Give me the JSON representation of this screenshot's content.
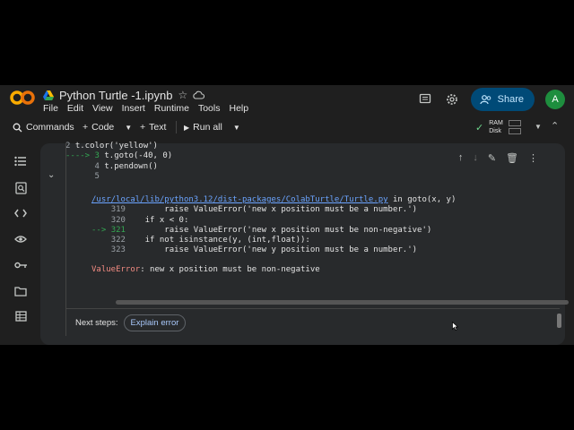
{
  "header": {
    "doc_title": "Python Turtle -1.ipynb",
    "menu": [
      "File",
      "Edit",
      "View",
      "Insert",
      "Runtime",
      "Tools",
      "Help"
    ],
    "share_label": "Share",
    "avatar_letter": "A"
  },
  "toolbar": {
    "commands_label": "Commands",
    "code_label": "Code",
    "text_label": "Text",
    "run_all_label": "Run all",
    "ram_label": "RAM",
    "disk_label": "Disk"
  },
  "code": {
    "lines": [
      {
        "num": "2",
        "prefix": "",
        "text": "t.color('yellow')"
      },
      {
        "num": "3",
        "prefix": "----> ",
        "text": "t.goto(-40, 0)"
      },
      {
        "num": "4",
        "prefix": "",
        "text": "t.pendown()"
      },
      {
        "num": "5",
        "prefix": "",
        "text": ""
      }
    ]
  },
  "traceback": {
    "path": "/usr/local/lib/python3.12/dist-packages/ColabTurtle/Turtle.py",
    "location": " in goto(x, y)",
    "lines": [
      {
        "num": "319",
        "arrow": "",
        "text": "        raise ValueError('new x position must be a number.')"
      },
      {
        "num": "320",
        "arrow": "",
        "text": "    if x < 0:"
      },
      {
        "num": "321",
        "arrow": "--> ",
        "text": "        raise ValueError('new x position must be non-negative')"
      },
      {
        "num": "322",
        "arrow": "",
        "text": "    if not isinstance(y, (int,float)):"
      },
      {
        "num": "323",
        "arrow": "",
        "text": "        raise ValueError('new y position must be a number.')"
      }
    ]
  },
  "error": {
    "type": "ValueError",
    "message": ": new x position must be non-negative"
  },
  "next_steps": {
    "label": "Next steps:",
    "button": "Explain error"
  },
  "colors": {
    "background": "#1f1f1f",
    "accent": "#004a77",
    "error": "#f28b82",
    "link": "#6ba4ff"
  }
}
